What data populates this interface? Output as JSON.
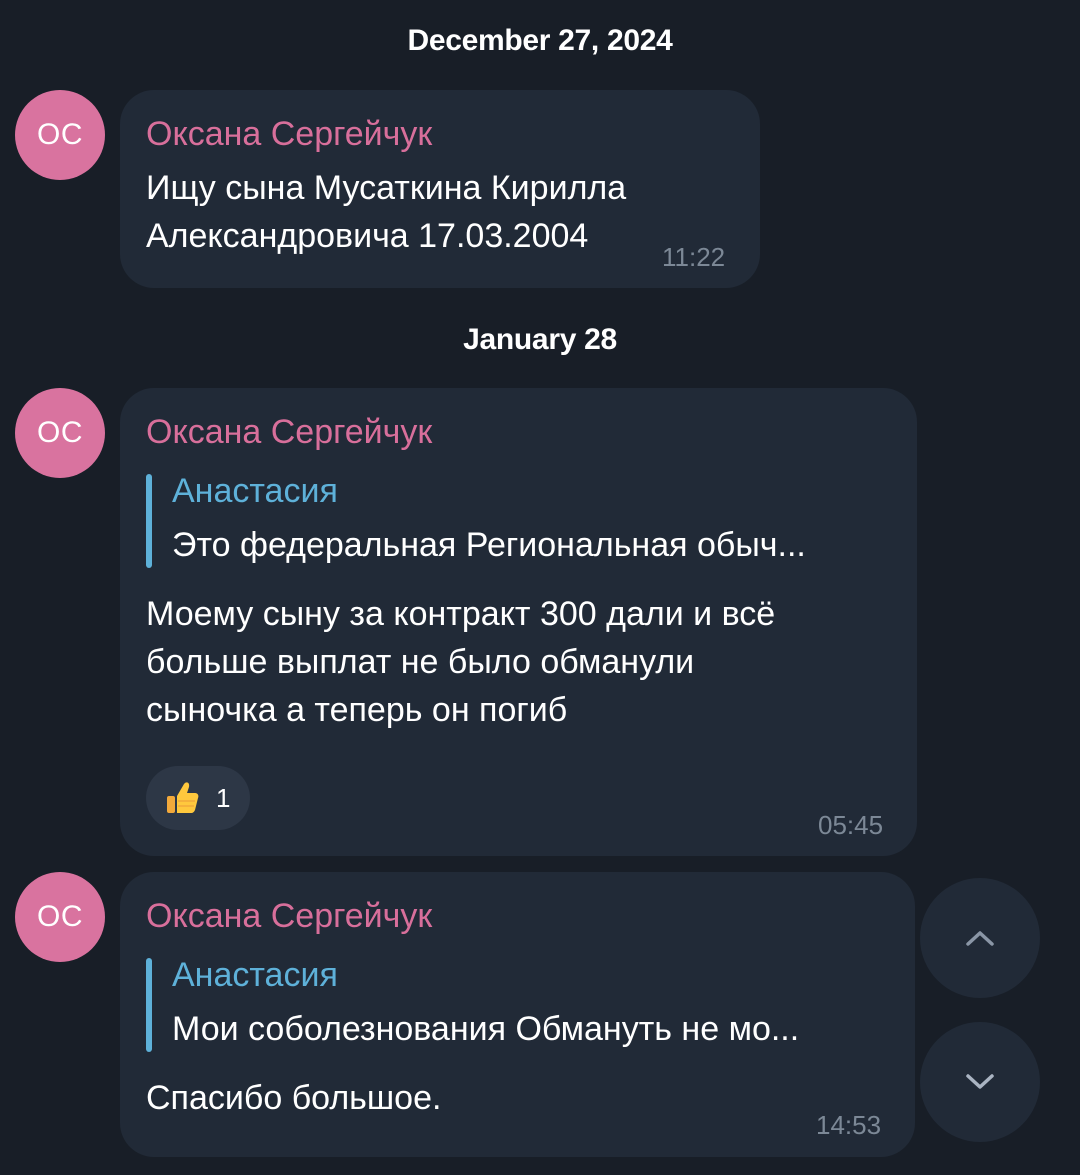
{
  "dates": [
    "December 27, 2024",
    "January 28"
  ],
  "messages": [
    {
      "avatar_initials": "OC",
      "sender": "Оксана Сергейчук",
      "text_lines": [
        "Ищу сына Мусаткина Кирилла",
        "Александровича 17.03.2004"
      ],
      "time": "11:22"
    },
    {
      "avatar_initials": "OC",
      "sender": "Оксана Сергейчук",
      "reply": {
        "name": "Анастасия",
        "text": "Это федеральная Региональная обыч..."
      },
      "text_lines": [
        "Моему сыну за контракт 300 дали и всё",
        "больше выплат не было обманули",
        "сыночка а теперь он погиб"
      ],
      "reaction": {
        "emoji": "thumbs-up",
        "count": "1"
      },
      "time": "05:45"
    },
    {
      "avatar_initials": "OC",
      "sender": "Оксана Сергейчук",
      "reply": {
        "name": "Анастасия",
        "text": "Мои соболезнования Обмануть не мо..."
      },
      "text_lines": [
        "Спасибо большое."
      ],
      "time": "14:53"
    }
  ],
  "controls": {
    "scroll_up_icon": "chevron-up-icon",
    "scroll_down_icon": "chevron-down-icon"
  },
  "colors": {
    "background": "#181e27",
    "bubble": "#212a37",
    "avatar": "#d9739f",
    "sender_name": "#d86f9b",
    "reply_accent": "#5eb1d9",
    "timestamp": "#7c8896"
  }
}
